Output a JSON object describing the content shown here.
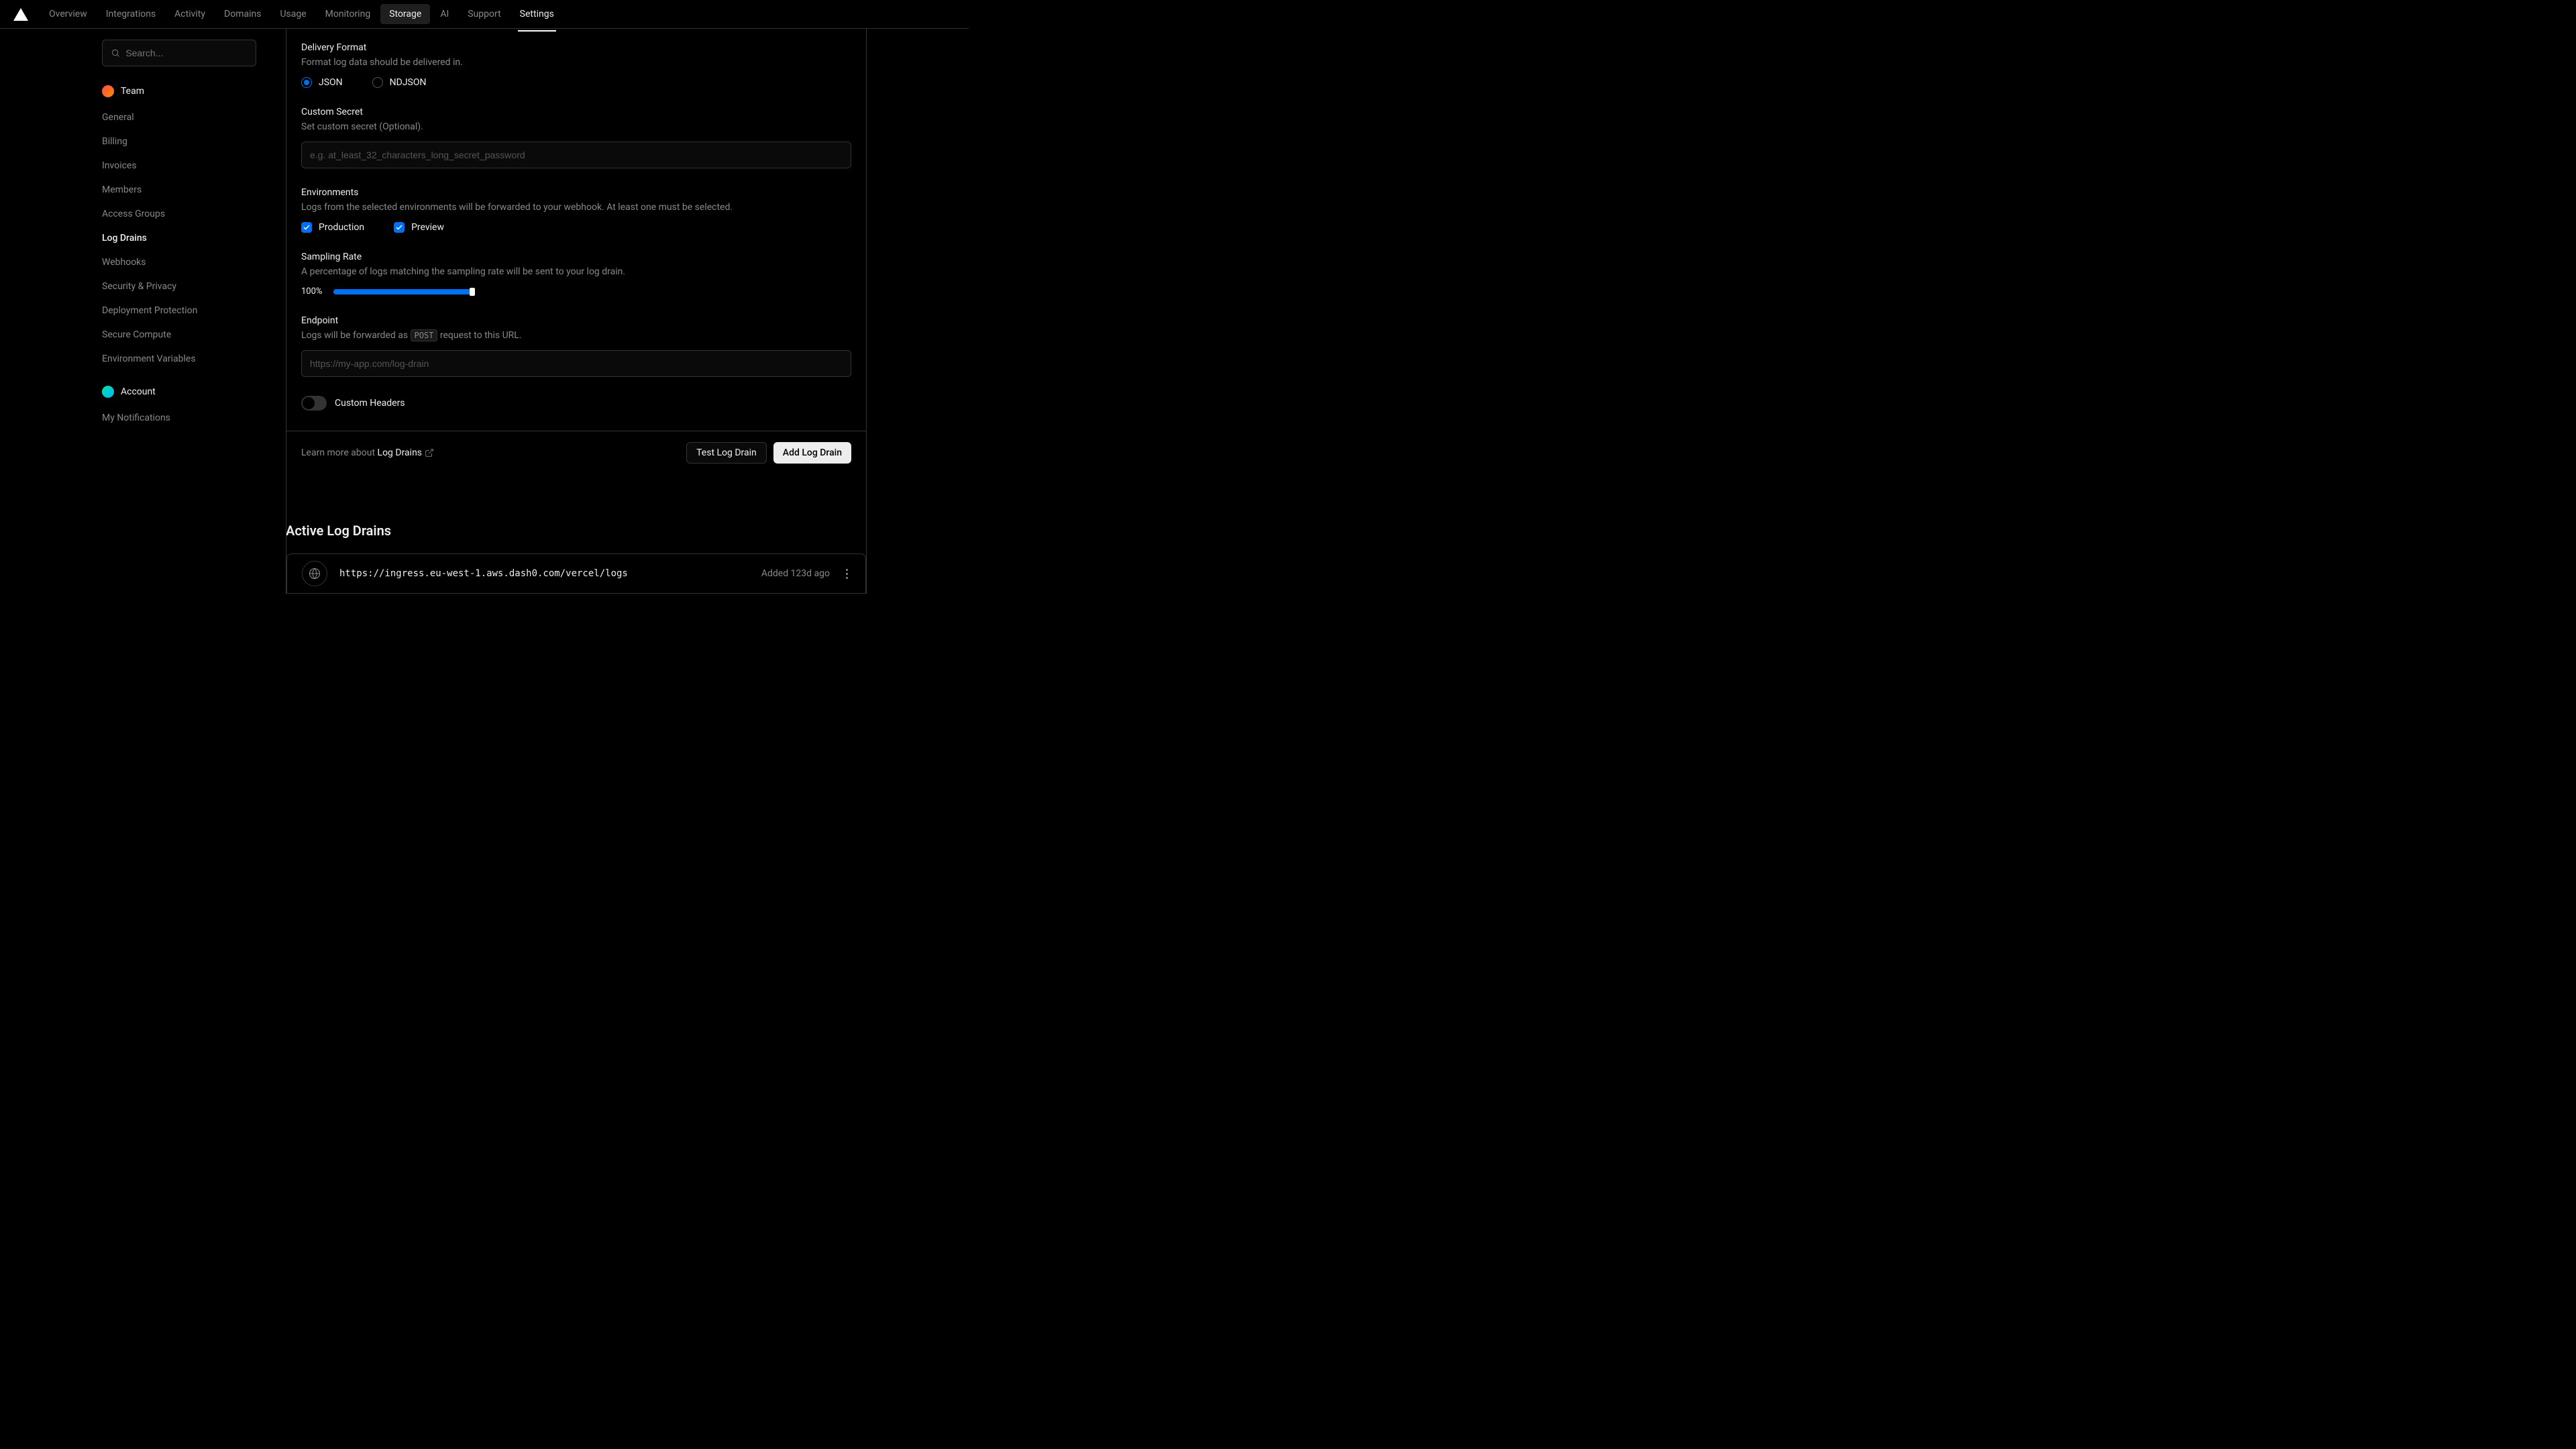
{
  "nav": {
    "items": [
      "Overview",
      "Integrations",
      "Activity",
      "Domains",
      "Usage",
      "Monitoring",
      "Storage",
      "AI",
      "Support",
      "Settings"
    ],
    "highlighted": "Storage",
    "active": "Settings"
  },
  "sidebar": {
    "search_placeholder": "Search...",
    "team_label": "Team",
    "account_label": "Account",
    "team_items": [
      "General",
      "Billing",
      "Invoices",
      "Members",
      "Access Groups",
      "Log Drains",
      "Webhooks",
      "Security & Privacy",
      "Deployment Protection",
      "Secure Compute",
      "Environment Variables"
    ],
    "team_active": "Log Drains",
    "account_items": [
      "My Notifications"
    ]
  },
  "form": {
    "delivery": {
      "label": "Delivery Format",
      "help": "Format log data should be delivered in.",
      "opt_json": "JSON",
      "opt_ndjson": "NDJSON"
    },
    "secret": {
      "label": "Custom Secret",
      "help": "Set custom secret (Optional).",
      "placeholder": "e.g. at_least_32_characters_long_secret_password"
    },
    "env": {
      "label": "Environments",
      "help": "Logs from the selected environments will be forwarded to your webhook. At least one must be selected.",
      "opt_prod": "Production",
      "opt_preview": "Preview"
    },
    "sampling": {
      "label": "Sampling Rate",
      "help": "A percentage of logs matching the sampling rate will be sent to your log drain.",
      "value": "100%"
    },
    "endpoint": {
      "label": "Endpoint",
      "help_pre": "Logs will be forwarded as ",
      "method": "POST",
      "help_post": " request to this URL.",
      "placeholder": "https://my-app.com/log-drain"
    },
    "custom_headers_label": "Custom Headers"
  },
  "footer": {
    "learn_pre": "Learn more about ",
    "learn_link": "Log Drains",
    "btn_test": "Test Log Drain",
    "btn_add": "Add Log Drain"
  },
  "active_section": {
    "title": "Active Log Drains",
    "drain_url": "https://ingress.eu-west-1.aws.dash0.com/vercel/logs",
    "added": "Added 123d ago"
  }
}
